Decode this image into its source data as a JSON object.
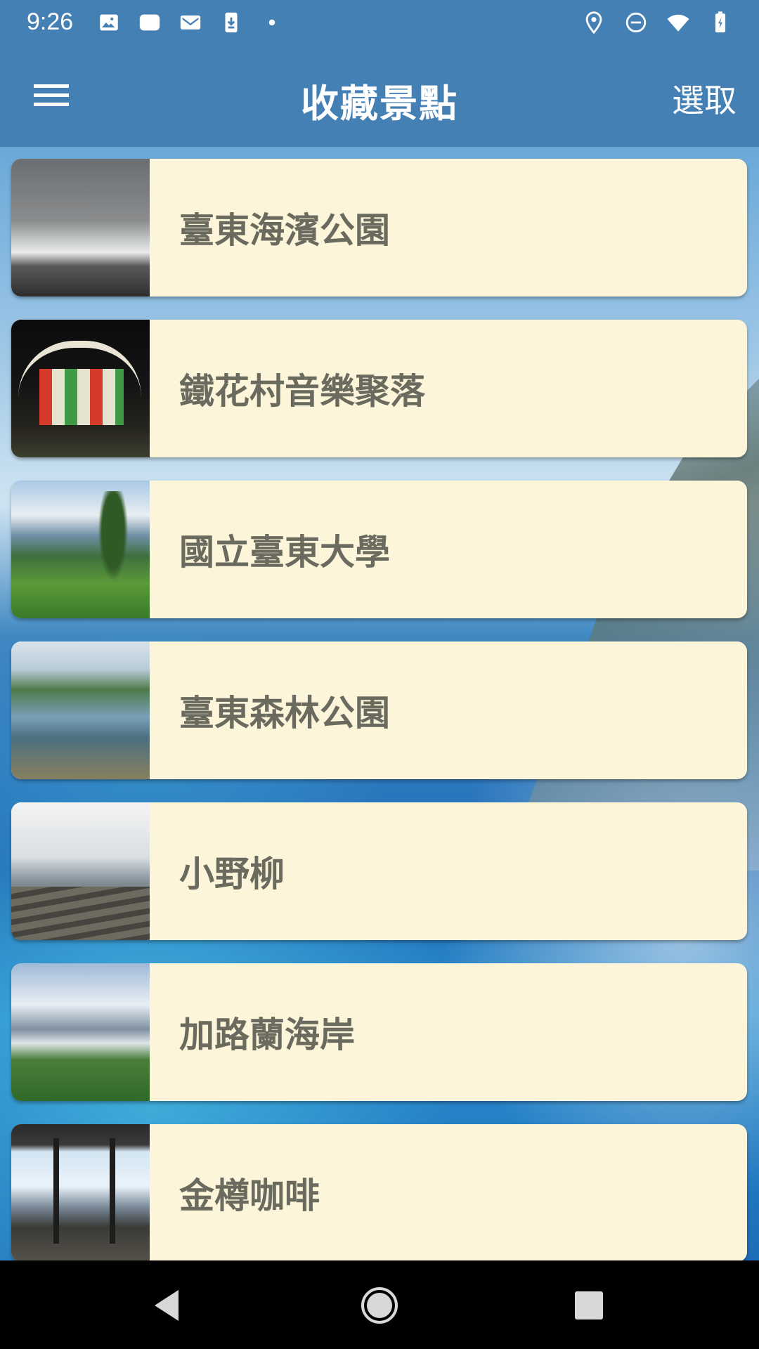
{
  "status_bar": {
    "time": "9:26",
    "left_icons": [
      "image-icon",
      "notification-icon",
      "gmail-icon",
      "download-icon",
      "dot-icon"
    ],
    "right_icons": [
      "location-icon",
      "do-not-disturb-icon",
      "wifi-icon",
      "battery-icon"
    ]
  },
  "app_bar": {
    "title": "收藏景點",
    "action_label": "選取",
    "menu_icon": "hamburger-menu-icon"
  },
  "favorites": [
    {
      "name": "臺東海濱公園",
      "thumb": "stormy-sea-photo"
    },
    {
      "name": "鐵花村音樂聚落",
      "thumb": "night-venue-photo"
    },
    {
      "name": "國立臺東大學",
      "thumb": "campus-lawn-photo"
    },
    {
      "name": "臺東森林公園",
      "thumb": "forest-lake-photo"
    },
    {
      "name": "小野柳",
      "thumb": "rocky-coast-photo"
    },
    {
      "name": "加路蘭海岸",
      "thumb": "coastline-photo"
    },
    {
      "name": "金樽咖啡",
      "thumb": "cafe-terrace-photo"
    }
  ],
  "colors": {
    "primary": "#4580b5",
    "card_background": "#fdf5da",
    "card_text": "#6a6a5e"
  },
  "nav_bar": {
    "buttons": [
      "back-icon",
      "home-icon",
      "recents-icon"
    ]
  }
}
